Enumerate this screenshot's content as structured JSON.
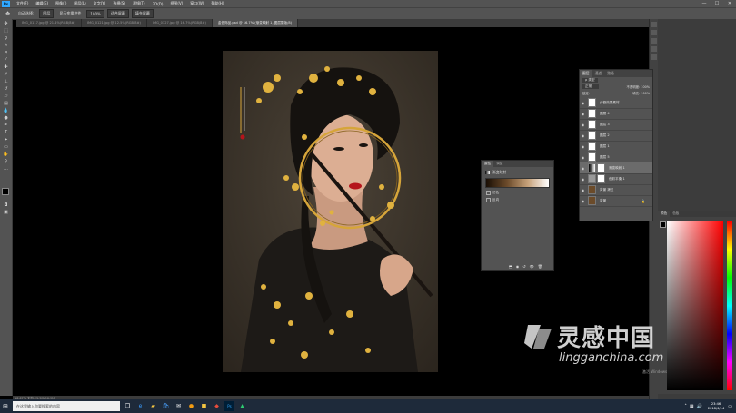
{
  "menubar": {
    "app_icon": "Ps",
    "items": [
      "文件(F)",
      "编辑(E)",
      "图像(I)",
      "图层(L)",
      "文字(Y)",
      "选择(S)",
      "滤镜(T)",
      "3D(D)",
      "视图(V)",
      "窗口(W)",
      "帮助(H)"
    ],
    "controls": [
      "—",
      "☐",
      "✕"
    ]
  },
  "optbar": {
    "items": [
      "自动选择:",
      "图层",
      "显示变换控件",
      "100%",
      "适合屏幕",
      "填充屏幕"
    ]
  },
  "tabs": [
    {
      "label": "IMG_0117.jpg @ 21.4%(RGB/8#)"
    },
    {
      "label": "IMG_0121.jpg @ 12.5%(RGB/8#)"
    },
    {
      "label": "IMG_0127.jpg @ 16.7%(RGB/8#)"
    },
    {
      "label": "金色饰品.psd @ 16.7% (渐变映射 1, 图层蒙版/8)"
    }
  ],
  "statusbar": {
    "text": "16.67%   文档:25.5M/96.9M"
  },
  "layers": {
    "tabs": [
      "图层",
      "通道",
      "路径"
    ],
    "filter": "ρ 类型",
    "blend": "正常",
    "opacity_label": "不透明度: 100%",
    "lock_label": "锁定:",
    "fill_label": "填充: 100%",
    "rows": [
      {
        "name": "分割效果素材"
      },
      {
        "name": "图层 4"
      },
      {
        "name": "图层 3"
      },
      {
        "name": "图层 2"
      },
      {
        "name": "图层 1"
      },
      {
        "name": "图层 5"
      },
      {
        "name": "渐变映射 1"
      },
      {
        "name": "色彩平衡 1"
      },
      {
        "name": "背景 拷贝"
      },
      {
        "name": "背景"
      }
    ]
  },
  "props": {
    "tabs": [
      "属性",
      "调整"
    ],
    "title": "渐变映射",
    "opt1": "仿色",
    "opt2": "反向"
  },
  "colorpanel": {
    "tabs": [
      "颜色",
      "色板"
    ]
  },
  "taskbar": {
    "search_placeholder": "在这里输入你要搜索的内容",
    "time": "23:46",
    "date": "2018/4/14"
  },
  "watermark": {
    "cn": "灵感中国",
    "en": "lingganchina.com",
    "activate": "激活 Windows"
  },
  "colors": {
    "accent": "#31a8ff",
    "panel": "#535353",
    "dark_panel": "#3c3c3c",
    "gold": "#d6a53a"
  }
}
